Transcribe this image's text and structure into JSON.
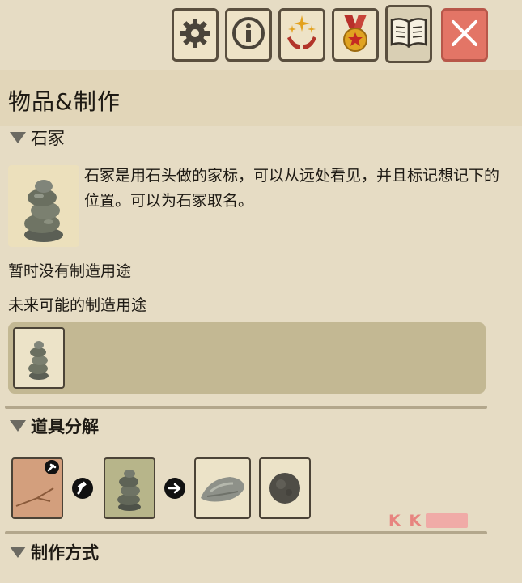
{
  "toolbar": {
    "buttons": [
      {
        "icon": "gear-icon"
      },
      {
        "icon": "info-icon"
      },
      {
        "icon": "sparkle-hands-icon"
      },
      {
        "icon": "medal-icon"
      },
      {
        "icon": "book-icon",
        "active": true
      },
      {
        "icon": "close-icon"
      }
    ]
  },
  "header": {
    "title": "物品&制作"
  },
  "item": {
    "section_title": "石冢",
    "description": "石冢是用石头做的家标，可以从远处看见，并且标记想记下的位置。可以为石冢取名。",
    "no_use_text": "暂时没有制造用途",
    "future_use_label": "未来可能的制造用途"
  },
  "decompose": {
    "section_title": "道具分解"
  },
  "crafting": {
    "section_title": "制作方式"
  },
  "watermark": {
    "text": "K  K"
  },
  "colors": {
    "background": "#e6dcc4",
    "header": "#e2d6b9",
    "panel": "#c3b893",
    "close_button": "#e37566"
  }
}
